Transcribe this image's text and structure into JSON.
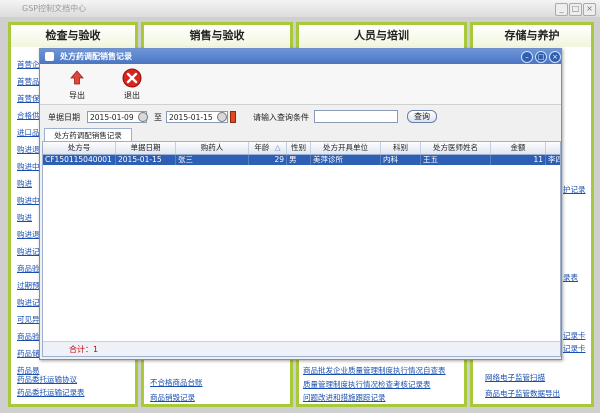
{
  "app": {
    "title": "GSP控制文档中心",
    "min": "_",
    "max": "□",
    "close": "×"
  },
  "panels": [
    {
      "title": "检查与验收",
      "links": [
        "首营企",
        "首营品",
        "首营保",
        "合格供",
        "进口品",
        "购进退",
        "购进中",
        "购进",
        "购进中",
        "购进",
        "购进退",
        "购进记",
        "商品验",
        "过期预",
        "购进记",
        "可见异",
        "商品验",
        "药品储",
        "药品易",
        "药品委托运输协议",
        "药品委托运输记录表"
      ]
    },
    {
      "title": "销售与验收",
      "links": [
        "不合格商品台账",
        "商品销毁记录"
      ]
    },
    {
      "title": "人员与培训",
      "links": [
        "商品批发企业质量管理制度执行情况自查表",
        "质量管理制度执行情况检查考核记录表",
        "问题改进和措施跟踪记录"
      ]
    },
    {
      "title": "存储与养护",
      "links": [
        "护记录",
        "录表",
        "记录卡",
        "记录卡",
        "网络电子监管扫描",
        "商品电子监管数据导出"
      ]
    }
  ],
  "dialog": {
    "title": "处方药调配销售记录",
    "toolbar": {
      "export_label": "导出",
      "exit_label": "退出"
    },
    "filters": {
      "date_label": "单据日期",
      "date_from": "2015-01-09",
      "to_label": "至",
      "date_to": "2015-01-15",
      "query_label": "请输入查询条件",
      "query_value": "",
      "search_label": "查询"
    },
    "tab_label": "处方药调配销售记录",
    "columns": [
      "处方号",
      "单据日期",
      "购药人",
      "年龄",
      "性别",
      "处方开具单位",
      "科别",
      "处方医师姓名",
      "金额"
    ],
    "sort_indicator": "△",
    "rows": [
      {
        "rx_no": "CF150115040001",
        "date": "2015-01-15",
        "buyer": "张三",
        "age": "29",
        "sex": "男",
        "unit": "美萍诊所",
        "dept": "内科",
        "doctor": "王五",
        "amount": "11",
        "extra": "李四"
      }
    ],
    "footer_total": "合计：1"
  }
}
